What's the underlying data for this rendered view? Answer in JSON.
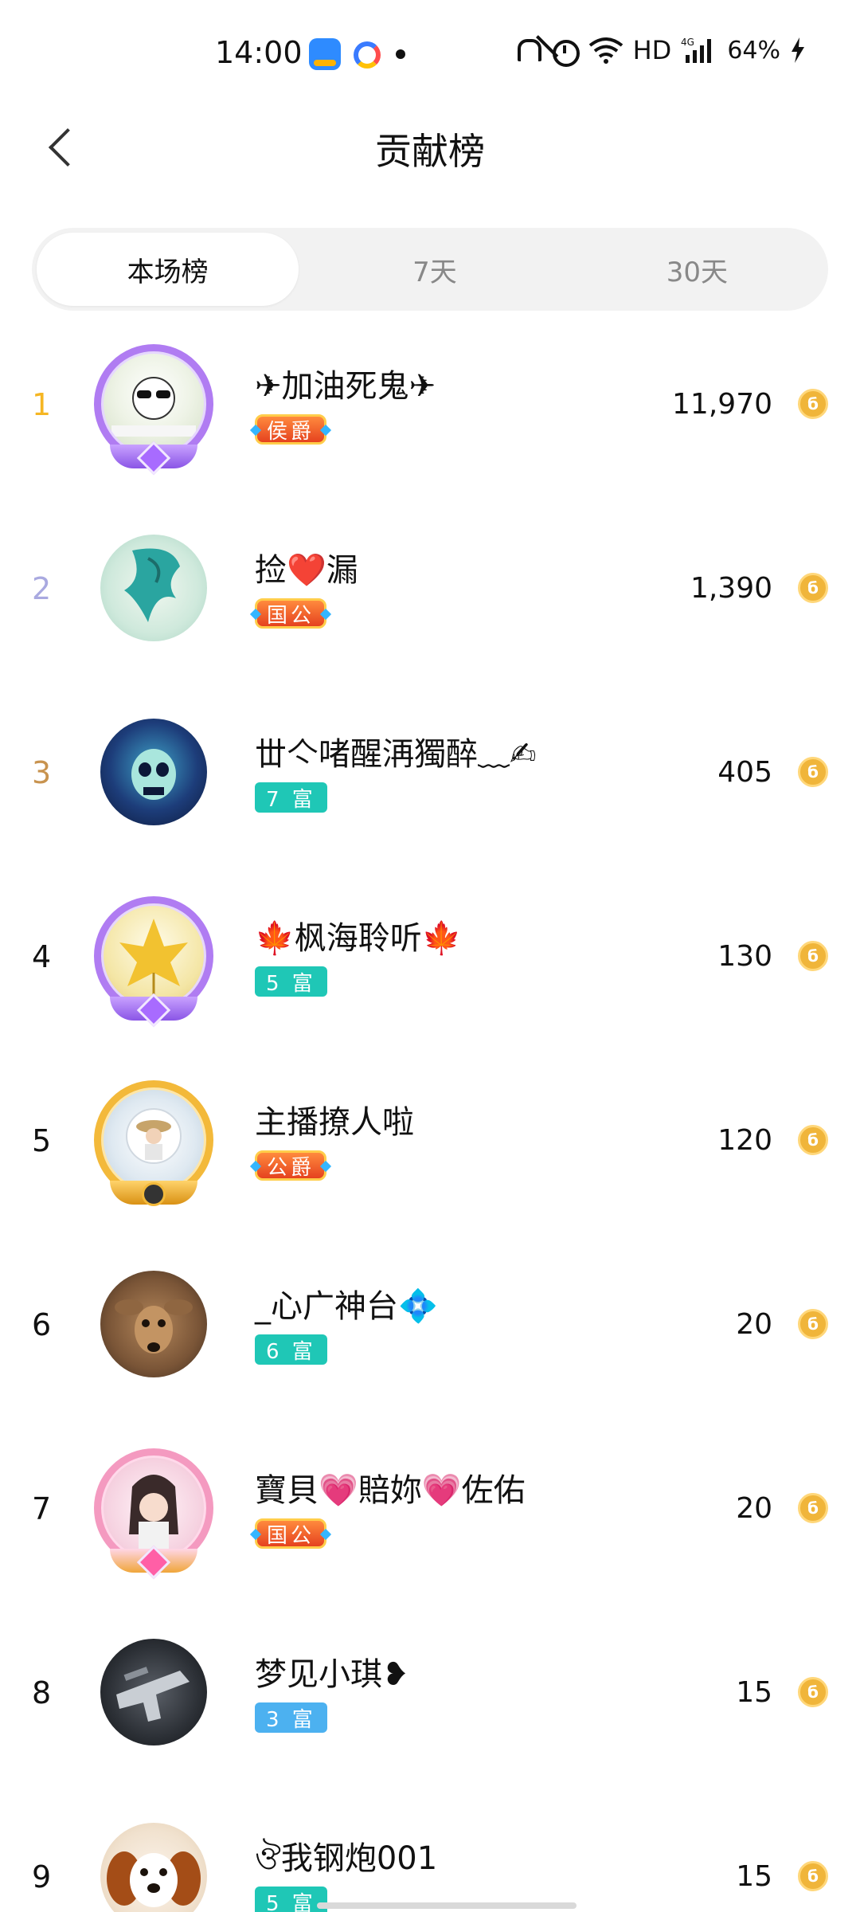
{
  "status_bar": {
    "time": "14:00",
    "network": "HD",
    "signal_label": "4G",
    "battery": "64%",
    "icons": [
      "app-icon-blue",
      "app-icon-ring",
      "dot-indicator",
      "mute-bell-icon",
      "alarm-icon",
      "wifi-icon",
      "signal-icon",
      "charging-icon"
    ]
  },
  "header": {
    "title": "贡献榜",
    "back_icon": "chevron-left-icon"
  },
  "tabs": [
    {
      "label": "本场榜",
      "active": true
    },
    {
      "label": "7天",
      "active": false
    },
    {
      "label": "30天",
      "active": false
    }
  ],
  "rank_colors": {
    "1": "#f5b623",
    "2": "#a9a9e0",
    "3": "#c8934f",
    "default": "#111111"
  },
  "coin_icon": "coin-icon",
  "list": [
    {
      "rank": "1",
      "name": "✈加油死鬼✈",
      "badge": "侯爵",
      "badge_type": "noble",
      "score": "11,970",
      "frame": "purple"
    },
    {
      "rank": "2",
      "name": "捡❤️漏",
      "badge": "国公",
      "badge_type": "noble",
      "score": "1,390",
      "frame": "none"
    },
    {
      "rank": "3",
      "name": "丗亽啫醒洅獨醉﹏✍",
      "badge": "7 富",
      "badge_type": "rich-teal",
      "score": "405",
      "frame": "none"
    },
    {
      "rank": "4",
      "name": "🍁枫海聆听🍁",
      "badge": "5 富",
      "badge_type": "rich-teal",
      "score": "130",
      "frame": "purple"
    },
    {
      "rank": "5",
      "name": "主播撩人啦",
      "badge": "公爵",
      "badge_type": "noble",
      "score": "120",
      "frame": "gold"
    },
    {
      "rank": "6",
      "name": "_心广神台💠",
      "badge": "6 富",
      "badge_type": "rich-teal",
      "score": "20",
      "frame": "none"
    },
    {
      "rank": "7",
      "name": "寶貝💗賠妳💗佐佑",
      "badge": "国公",
      "badge_type": "noble",
      "score": "20",
      "frame": "pink"
    },
    {
      "rank": "8",
      "name": "梦见小琪❥",
      "badge": "3 富",
      "badge_type": "rich-blue",
      "score": "15",
      "frame": "none"
    },
    {
      "rank": "9",
      "name": "ঔ我钢炮001",
      "badge": "5 富",
      "badge_type": "rich-teal",
      "score": "15",
      "frame": "none"
    }
  ]
}
